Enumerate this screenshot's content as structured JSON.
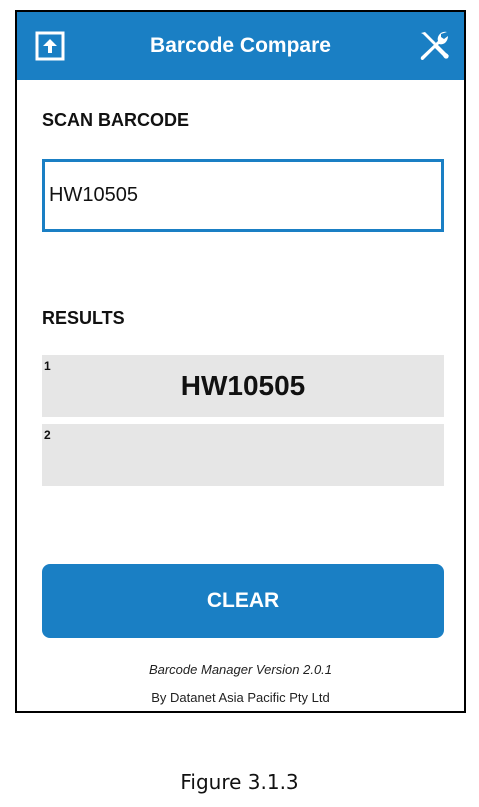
{
  "app": {
    "title": "Barcode Compare",
    "left_icon": "upload-arrow-icon",
    "right_icon": "wrench-screwdriver-icon",
    "accent_color": "#1a7fc4"
  },
  "scan": {
    "label": "SCAN BARCODE",
    "value": "HW10505"
  },
  "results": {
    "label": "RESULTS",
    "rows": [
      {
        "index": "1",
        "value": "HW10505"
      },
      {
        "index": "2",
        "value": ""
      }
    ]
  },
  "actions": {
    "clear_label": "CLEAR"
  },
  "footer": {
    "version": "Barcode Manager Version 2.0.1",
    "company": "By Datanet Asia Pacific Pty Ltd"
  },
  "caption": "Figure 3.1.3"
}
